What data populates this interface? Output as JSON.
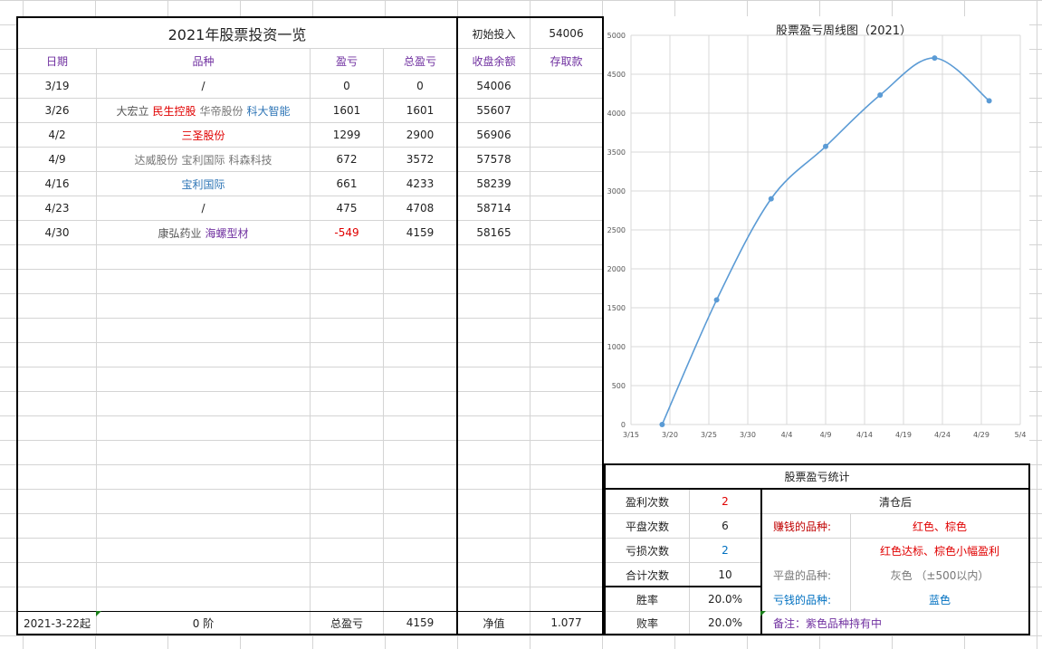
{
  "table": {
    "title": "2021年股票投资一览",
    "initial_label": "初始投入",
    "initial_value": "54006",
    "headers": [
      "日期",
      "品种",
      "盈亏",
      "总盈亏",
      "收盘余额",
      "存取款"
    ],
    "rows": [
      {
        "date": "3/19",
        "stocks": [
          {
            "name": "/",
            "color": "#222222"
          }
        ],
        "pnl": "0",
        "total": "0",
        "balance": "54006",
        "deposit": ""
      },
      {
        "date": "3/26",
        "stocks": [
          {
            "name": "大宏立",
            "color": "#555555"
          },
          {
            "name": "民生控股",
            "color": "#e00000"
          },
          {
            "name": "华帝股份",
            "color": "#777777"
          },
          {
            "name": "科大智能",
            "color": "#2e75b6"
          }
        ],
        "pnl": "1601",
        "total": "1601",
        "balance": "55607",
        "deposit": ""
      },
      {
        "date": "4/2",
        "stocks": [
          {
            "name": "三圣股份",
            "color": "#e00000"
          }
        ],
        "pnl": "1299",
        "total": "2900",
        "balance": "56906",
        "deposit": ""
      },
      {
        "date": "4/9",
        "stocks": [
          {
            "name": "达威股份",
            "color": "#777777"
          },
          {
            "name": "宝利国际",
            "color": "#777777"
          },
          {
            "name": "科森科技",
            "color": "#777777"
          }
        ],
        "pnl": "672",
        "total": "3572",
        "balance": "57578",
        "deposit": ""
      },
      {
        "date": "4/16",
        "stocks": [
          {
            "name": "宝利国际",
            "color": "#2e75b6"
          }
        ],
        "pnl": "661",
        "total": "4233",
        "balance": "58239",
        "deposit": ""
      },
      {
        "date": "4/23",
        "stocks": [
          {
            "name": "/",
            "color": "#222222"
          }
        ],
        "pnl": "475",
        "total": "4708",
        "balance": "58714",
        "deposit": ""
      },
      {
        "date": "4/30",
        "stocks": [
          {
            "name": "康弘药业",
            "color": "#555555"
          },
          {
            "name": "海螺型材",
            "color": "#7030a0"
          }
        ],
        "pnl": "-549",
        "total": "4159",
        "balance": "58165",
        "deposit": "",
        "pnl_color": "#e00000"
      }
    ],
    "footer": {
      "start": "2021-3-22起",
      "stage": "0 阶",
      "total_label": "总盈亏",
      "total_value": "4159",
      "nav_label": "净值",
      "nav_value": "1.077"
    }
  },
  "chart_data": {
    "type": "line",
    "title": "股票盈亏周线图（2021）",
    "x": [
      "3/19",
      "3/26",
      "4/2",
      "4/9",
      "4/16",
      "4/23",
      "4/30"
    ],
    "x_ticks": [
      "3/15",
      "3/20",
      "3/25",
      "3/30",
      "4/4",
      "4/9",
      "4/14",
      "4/19",
      "4/24",
      "4/29",
      "5/4"
    ],
    "values": [
      0,
      1601,
      2900,
      3572,
      4233,
      4708,
      4159
    ],
    "ylim": [
      0,
      5000
    ],
    "yticks": [
      "0",
      "500",
      "1000",
      "1500",
      "2000",
      "2500",
      "3000",
      "3500",
      "4000",
      "4500",
      "5000"
    ],
    "smooth": true,
    "grid": true,
    "color": "#5b9bd5"
  },
  "stats": {
    "title": "股票盈亏统计",
    "rows": [
      {
        "label": "盈利次数",
        "value": "2",
        "color": "#e00000"
      },
      {
        "label": "平盘次数",
        "value": "6",
        "color": "#222222"
      },
      {
        "label": "亏损次数",
        "value": "2",
        "color": "#0070c0"
      },
      {
        "label": "合计次数",
        "value": "10",
        "color": "#222222"
      },
      {
        "label": "胜率",
        "value": "20.0%",
        "color": "#222222"
      },
      {
        "label": "败率",
        "value": "20.0%",
        "color": "#222222"
      }
    ],
    "legend": {
      "header": "清仓后",
      "earn_label": "赚钱的品种:",
      "earn_value": "红色、棕色",
      "earn_note": "红色达标、棕色小幅盈利",
      "flat_label": "平盘的品种:",
      "flat_value": "灰色  （±500以内）",
      "loss_label": "亏钱的品种:",
      "loss_value": "蓝色",
      "remark": "备注：紫色品种持有中"
    }
  }
}
